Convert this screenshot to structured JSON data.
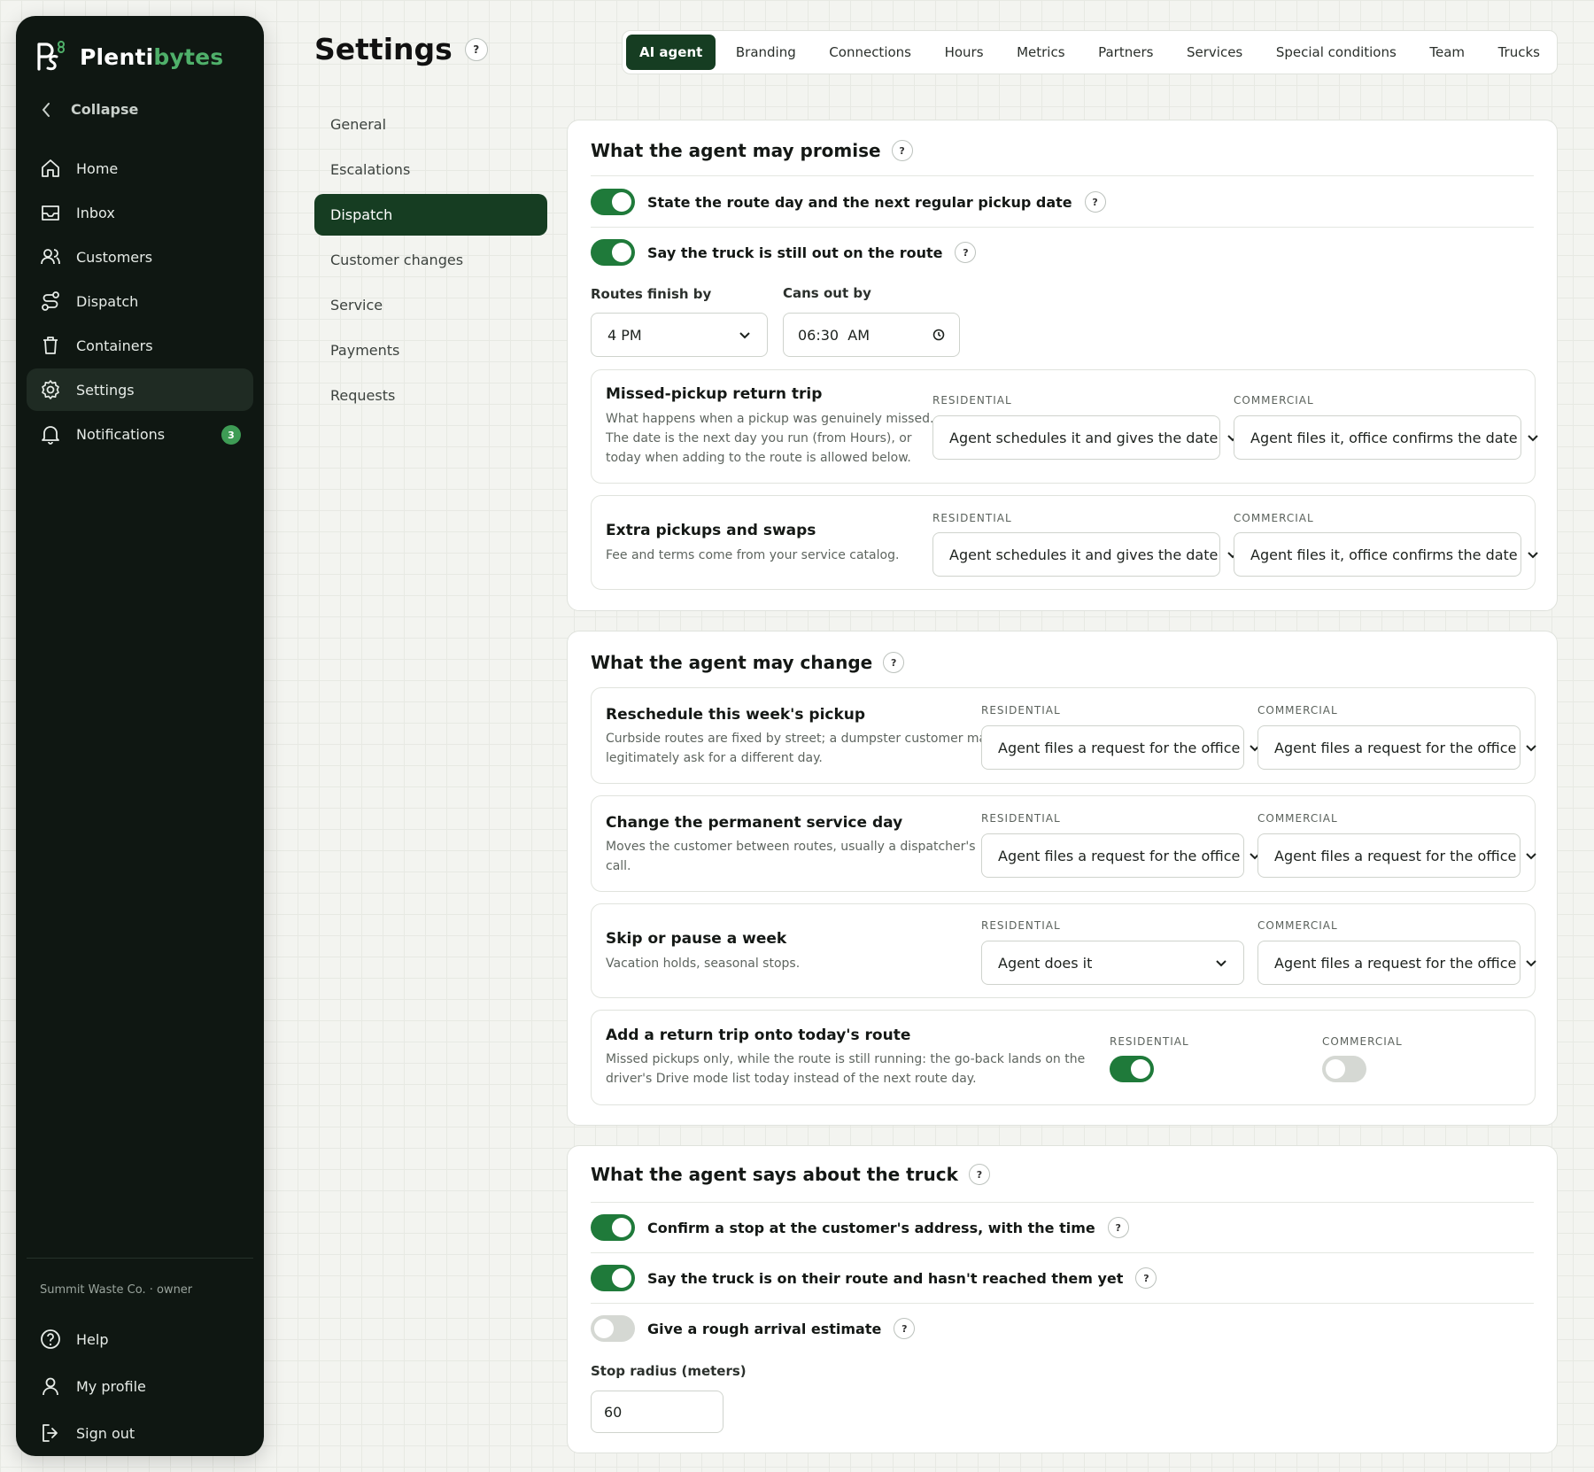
{
  "sidebar": {
    "brand_prefix": "Plenti",
    "brand_suffix": "bytes",
    "collapse_label": "Collapse",
    "items": [
      {
        "label": "Home",
        "icon": "home-icon"
      },
      {
        "label": "Inbox",
        "icon": "inbox-icon"
      },
      {
        "label": "Customers",
        "icon": "users-icon"
      },
      {
        "label": "Dispatch",
        "icon": "route-icon"
      },
      {
        "label": "Containers",
        "icon": "trash-icon"
      },
      {
        "label": "Settings",
        "icon": "gear-icon",
        "active": true
      },
      {
        "label": "Notifications",
        "icon": "bell-icon",
        "badge": "3"
      }
    ],
    "org": "Summit Waste Co. · owner",
    "bottom": [
      {
        "label": "Help",
        "icon": "help-icon"
      },
      {
        "label": "My profile",
        "icon": "user-icon"
      },
      {
        "label": "Sign out",
        "icon": "signout-icon"
      }
    ]
  },
  "header": {
    "title": "Settings",
    "help": "?",
    "tabs": [
      "AI agent",
      "Branding",
      "Connections",
      "Hours",
      "Metrics",
      "Partners",
      "Services",
      "Special conditions",
      "Team",
      "Trucks"
    ],
    "active_tab": "AI agent"
  },
  "subnav": {
    "items": [
      "General",
      "Escalations",
      "Dispatch",
      "Customer changes",
      "Service",
      "Payments",
      "Requests"
    ],
    "active": "Dispatch"
  },
  "promise": {
    "title": "What the agent may promise",
    "toggles": [
      {
        "label": "State the route day and the next regular pickup date",
        "on": true
      },
      {
        "label": "Say the truck is still out on the route",
        "on": true
      }
    ],
    "routes_finish_label": "Routes finish by",
    "routes_finish_value": "4 PM",
    "cans_out_label": "Cans out by",
    "cans_out_value": "06:30  AM",
    "rows": [
      {
        "title": "Missed-pickup return trip",
        "desc": [
          "What happens when a pickup was genuinely missed.",
          "The date is the next day you run (from Hours), or",
          "today when adding to the route is allowed below."
        ],
        "res_label": "RESIDENTIAL",
        "res_value": "Agent schedules it and gives the date",
        "com_label": "COMMERCIAL",
        "com_value": "Agent files it, office confirms the date"
      },
      {
        "title": "Extra pickups and swaps",
        "desc": [
          "Fee and terms come from your service catalog."
        ],
        "res_label": "RESIDENTIAL",
        "res_value": "Agent schedules it and gives the date",
        "com_label": "COMMERCIAL",
        "com_value": "Agent files it, office confirms the date"
      }
    ]
  },
  "change": {
    "title": "What the agent may change",
    "rows": [
      {
        "title": "Reschedule this week's pickup",
        "desc": [
          "Curbside routes are fixed by street; a dumpster customer may",
          "legitimately ask for a different day."
        ],
        "res_label": "RESIDENTIAL",
        "res_value": "Agent files a request for the office",
        "com_label": "COMMERCIAL",
        "com_value": "Agent files a request for the office"
      },
      {
        "title": "Change the permanent service day",
        "desc": [
          "Moves the customer between routes, usually a dispatcher's",
          "call."
        ],
        "res_label": "RESIDENTIAL",
        "res_value": "Agent files a request for the office",
        "com_label": "COMMERCIAL",
        "com_value": "Agent files a request for the office"
      },
      {
        "title": "Skip or pause a week",
        "desc": [
          "Vacation holds, seasonal stops."
        ],
        "res_label": "RESIDENTIAL",
        "res_value": "Agent does it",
        "com_label": "COMMERCIAL",
        "com_value": "Agent files a request for the office"
      }
    ],
    "return_trip": {
      "title": "Add a return trip onto today's route",
      "desc": [
        "Missed pickups only, while the route is still running: the go-back lands on the",
        "driver's Drive mode list today instead of the next route day."
      ],
      "res_label": "RESIDENTIAL",
      "res_on": true,
      "com_label": "COMMERCIAL",
      "com_on": false
    }
  },
  "truck": {
    "title": "What the agent says about the truck",
    "toggles": [
      {
        "label": "Confirm a stop at the customer's address, with the time",
        "on": true
      },
      {
        "label": "Say the truck is on their route and hasn't reached them yet",
        "on": true
      },
      {
        "label": "Give a rough arrival estimate",
        "on": false
      }
    ],
    "radius_label": "Stop radius (meters)",
    "radius_value": "60"
  },
  "colors": {
    "brand_dark": "#163d22",
    "toggle_on": "#1f7a3a",
    "sidebar_bg": "#0f1712",
    "accent": "#4fb06a"
  }
}
